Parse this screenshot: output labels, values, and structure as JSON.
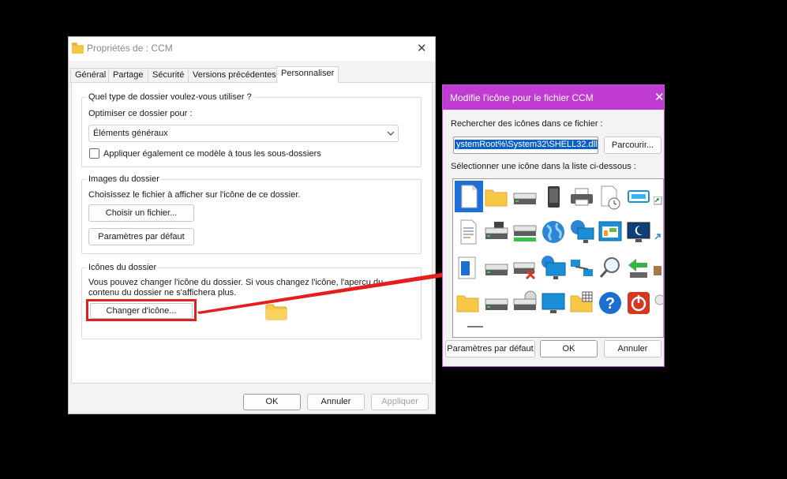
{
  "props": {
    "title": "Propriétés de : CCM",
    "close_icon": "close-icon",
    "tabs": [
      {
        "label": "Général",
        "active": false
      },
      {
        "label": "Partage",
        "active": false
      },
      {
        "label": "Sécurité",
        "active": false
      },
      {
        "label": "Versions précédentes",
        "active": false
      },
      {
        "label": "Personnaliser",
        "active": true
      }
    ],
    "group_type": {
      "title": "Quel type de dossier voulez-vous utiliser ?",
      "optimize_label": "Optimiser ce dossier pour :",
      "optimize_value": "Éléments généraux",
      "apply_all_label": "Appliquer également ce modèle à tous les sous-dossiers",
      "apply_all_checked": false
    },
    "group_images": {
      "title": "Images du dossier",
      "description": "Choisissez le fichier à afficher sur l'icône de ce dossier.",
      "choose_file_button": "Choisir un fichier...",
      "default_button": "Paramètres par défaut"
    },
    "group_icons": {
      "title": "Icônes du dossier",
      "description_line1": "Vous pouvez changer l'icône du dossier. Si vous changez l'icône, l'aperçu du",
      "description_line2": "contenu du dossier ne s'affichera plus.",
      "change_icon_button": "Changer d'icône...",
      "preview_icon": "folder-icon"
    },
    "footer": {
      "ok": "OK",
      "cancel": "Annuler",
      "apply": "Appliquer"
    }
  },
  "iconwin": {
    "title": "Modifie l'icône pour le fichier CCM",
    "close_icon": "close-icon",
    "search_label": "Rechercher des icônes dans ce fichier :",
    "path_value": "ystemRoot%\\System32\\SHELL32.dll",
    "browse_button": "Parcourir...",
    "list_label": "Sélectionner une icône dans la liste ci-dessous :",
    "icons": [
      [
        "blank-document-icon",
        "folder-icon",
        "drive-icon",
        "mobile-device-icon",
        "printer-icon",
        "clock-document-icon",
        "display-window-icon",
        "shortcut-icon"
      ],
      [
        "text-document-icon",
        "floppy-drive-icon",
        "network-drive-icon",
        "globe-icon",
        "network-globe-icon",
        "control-panel-icon",
        "sleep-moon-icon",
        "shortcut-arrow-icon"
      ],
      [
        "window-document-icon",
        "drive-icon",
        "disconnected-drive-icon",
        "network-computer-icon",
        "network-connections-icon",
        "search-magnifier-icon",
        "recycle-arrow-icon",
        "folder-brown-icon"
      ],
      [
        "folder-icon",
        "drive-icon",
        "cd-drive-icon",
        "monitor-icon",
        "folder-grid-icon",
        "help-question-icon",
        "power-icon",
        "light-bulb-icon"
      ]
    ],
    "footer": {
      "default": "Paramètres par défaut",
      "ok": "OK",
      "cancel": "Annuler"
    }
  },
  "colors": {
    "accent_titlebar": "#bf3bd2",
    "highlight": "#e41e1e",
    "selection": "#0b5fc9"
  }
}
